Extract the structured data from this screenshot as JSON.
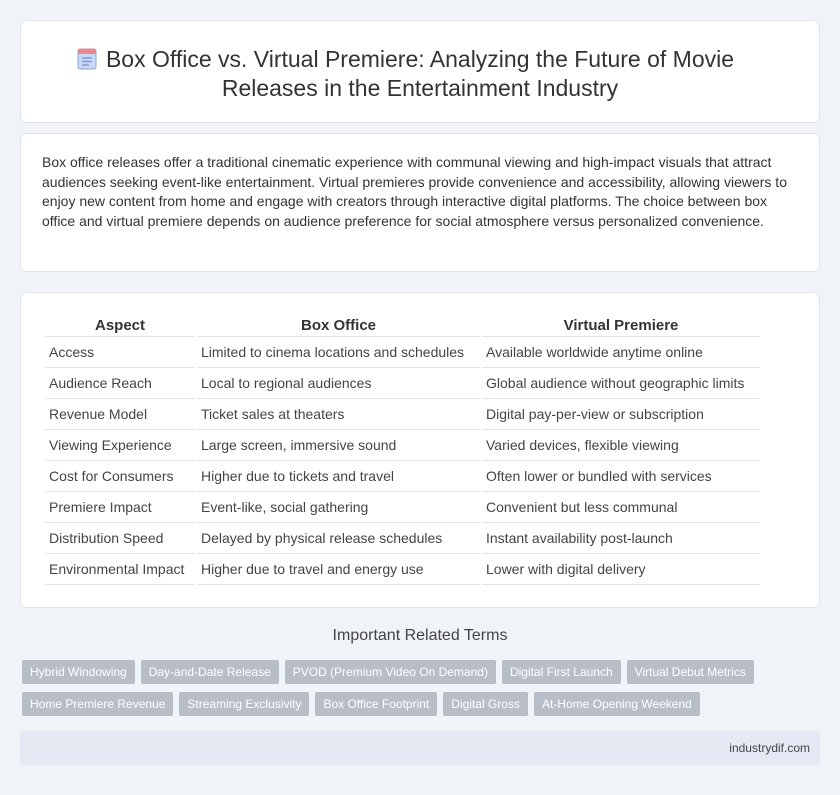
{
  "header": {
    "title": "Box Office vs. Virtual Premiere: Analyzing the Future of Movie Releases in the Entertainment Industry",
    "icon": "document-icon"
  },
  "intro": {
    "text": "Box office releases offer a traditional cinematic experience with communal viewing and high-impact visuals that attract audiences seeking event-like entertainment. Virtual premieres provide convenience and accessibility, allowing viewers to enjoy new content from home and engage with creators through interactive digital platforms. The choice between box office and virtual premiere depends on audience preference for social atmosphere versus personalized convenience."
  },
  "table": {
    "headers": [
      "Aspect",
      "Box Office",
      "Virtual Premiere"
    ],
    "rows": [
      [
        "Access",
        "Limited to cinema locations and schedules",
        "Available worldwide anytime online"
      ],
      [
        "Audience Reach",
        "Local to regional audiences",
        "Global audience without geographic limits"
      ],
      [
        "Revenue Model",
        "Ticket sales at theaters",
        "Digital pay-per-view or subscription"
      ],
      [
        "Viewing Experience",
        "Large screen, immersive sound",
        "Varied devices, flexible viewing"
      ],
      [
        "Cost for Consumers",
        "Higher due to tickets and travel",
        "Often lower or bundled with services"
      ],
      [
        "Premiere Impact",
        "Event-like, social gathering",
        "Convenient but less communal"
      ],
      [
        "Distribution Speed",
        "Delayed by physical release schedules",
        "Instant availability post-launch"
      ],
      [
        "Environmental Impact",
        "Higher due to travel and energy use",
        "Lower with digital delivery"
      ]
    ]
  },
  "terms": {
    "title": "Important Related Terms",
    "row1": [
      "Hybrid Windowing",
      "Day-and-Date Release",
      "PVOD (Premium Video On Demand)",
      "Digital First Launch",
      "Virtual Debut Metrics"
    ],
    "row2": [
      "Home Premiere Revenue",
      "Streaming Exclusivity",
      "Box Office Footprint",
      "Digital Gross",
      "At-Home Opening Weekend"
    ]
  },
  "footer": {
    "text": "industrydif.com"
  },
  "colors": {
    "background": "#f0f3f8",
    "tag": "#b8bec8",
    "footer": "#e4e9f3"
  }
}
